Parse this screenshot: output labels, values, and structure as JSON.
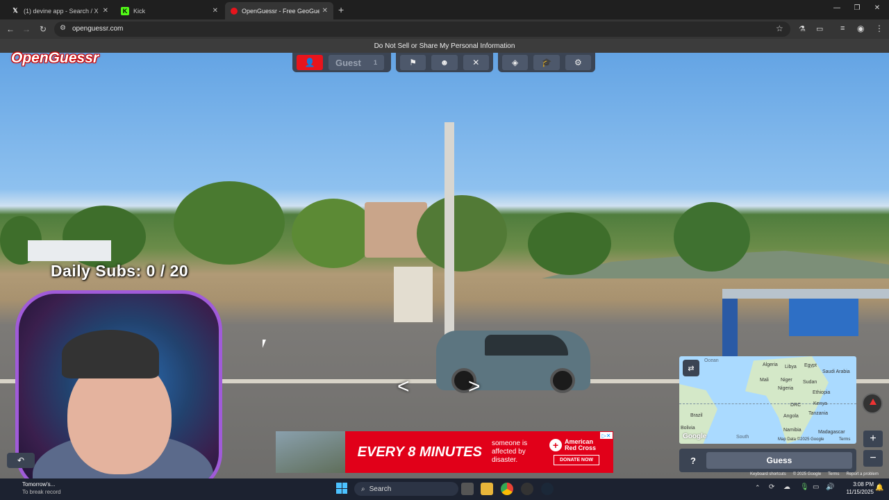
{
  "browser": {
    "tabs": [
      {
        "title": "(1) devine app - Search / X",
        "icon": "x-logo-icon"
      },
      {
        "title": "Kick",
        "icon": "kick-logo-icon"
      },
      {
        "title": "OpenGuessr - Free GeoGuessr",
        "icon": "openguessr-icon"
      }
    ],
    "new_tab": "+",
    "url": "openguessr.com",
    "window_controls": {
      "minimize": "—",
      "maximize": "❐",
      "close": "✕"
    }
  },
  "privacy_bar": "Do Not Sell or Share My Personal Information",
  "game": {
    "logo": "OpenGuessr",
    "player_name": "Guest",
    "player_count": "1",
    "guess_label": "Guess",
    "help_label": "?",
    "nav_left": "<",
    "nav_right": ">",
    "zoom_in": "+",
    "zoom_out": "−",
    "back_label": "↶"
  },
  "overlay": {
    "daily_subs": "Daily Subs:  0 / 20"
  },
  "ad": {
    "headline": "EVERY 8 MINUTES",
    "sub": "someone is affected by disaster.",
    "brand": "American Red Cross",
    "cta": "DONATE NOW"
  },
  "map": {
    "labels": {
      "ocean": "Ocean",
      "algeria": "Algeria",
      "libya": "Libya",
      "egypt": "Egypt",
      "saudi": "Saudi Arabia",
      "mali": "Mali",
      "niger": "Niger",
      "sudan": "Sudan",
      "nigeria": "Nigeria",
      "ethiopia": "Ethiopia",
      "drc": "DRC",
      "kenya": "Kenya",
      "tanzania": "Tanzania",
      "angola": "Angola",
      "brazil": "Brazil",
      "namibia": "Namibia",
      "madagascar": "Madagascar",
      "south": "South",
      "bolivia": "Bolivia"
    },
    "attribution": "Map Data ©2025 Google",
    "terms": "Terms",
    "google": "Google"
  },
  "attribution_row": [
    "Keyboard shortcuts",
    "© 2025 Google",
    "Terms",
    "Report a problem"
  ],
  "taskbar": {
    "weather_title": "Tomorrow's...",
    "weather_sub": "To break record",
    "search_label": "Search",
    "time": "3:08 PM",
    "date": "11/15/2025"
  }
}
